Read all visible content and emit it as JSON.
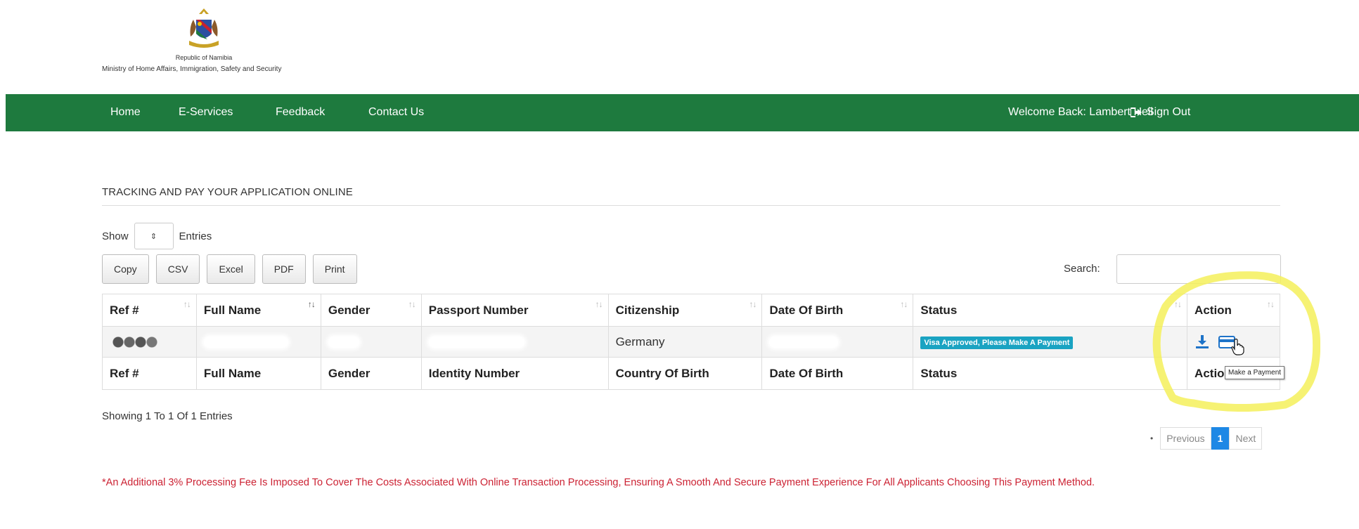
{
  "header": {
    "republic": "Republic of Namibia",
    "ministry": "Ministry of Home Affairs, Immigration, Safety and Security"
  },
  "nav": {
    "home": "Home",
    "eservices": "E-Services",
    "feedback": "Feedback",
    "contact": "Contact Us",
    "welcome": "Welcome Back: Lambert Heil",
    "signout": "Sign Out"
  },
  "page": {
    "title": "TRACKING AND PAY YOUR APPLICATION ONLINE"
  },
  "length_menu": {
    "show": "Show",
    "entries": "Entries"
  },
  "buttons": {
    "copy": "Copy",
    "csv": "CSV",
    "excel": "Excel",
    "pdf": "PDF",
    "print": "Print"
  },
  "search": {
    "label": "Search:",
    "value": ""
  },
  "table": {
    "header": [
      "Ref #",
      "Full Name",
      "Gender",
      "Passport Number",
      "Citizenship",
      "Date Of Birth",
      "Status",
      "Action"
    ],
    "footer": [
      "Ref #",
      "Full Name",
      "Gender",
      "Identity Number",
      "Country Of Birth",
      "Date Of Birth",
      "Status",
      "Action"
    ],
    "row": {
      "citizenship": "Germany",
      "status": "Visa Approved, Please Make A Payment"
    }
  },
  "tooltip": "Make a Payment",
  "info": "Showing 1 To 1 Of 1 Entries",
  "pagination": {
    "previous": "Previous",
    "current": "1",
    "next": "Next"
  },
  "note": "*An Additional 3% Processing Fee Is Imposed To Cover The Costs Associated With Online Transaction Processing, Ensuring A Smooth And Secure Payment Experience For All Applicants Choosing This Payment Method.",
  "colors": {
    "navbar": "#1e7a3e",
    "badge": "#1aa3c2",
    "pagination_active": "#1e88e5",
    "note_red": "#cc2233",
    "highlight": "#f5f05a"
  },
  "icons": [
    "coat-of-arms-logo",
    "sign-out-icon",
    "sort-icon",
    "download-icon",
    "credit-card-icon",
    "hand-cursor-icon"
  ]
}
